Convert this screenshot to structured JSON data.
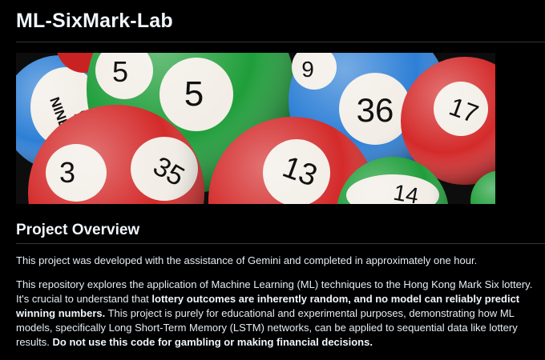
{
  "title": "ML-SixMark-Lab",
  "hero": {
    "ball_numbers": [
      "5",
      "5",
      "9",
      "36",
      "17",
      "9",
      "NINE",
      "3",
      "35",
      "13",
      "14"
    ]
  },
  "overview": {
    "heading": "Project Overview",
    "intro": "This project was developed with the assistance of Gemini and completed in approximately one hour.",
    "p2_seg1": "This repository explores the application of Machine Learning (ML) techniques to the Hong Kong Mark Six lottery. It's crucial to understand that ",
    "p2_bold1": "lottery outcomes are inherently random, and no model can reliably predict winning numbers.",
    "p2_seg2": " This project is purely for educational and experimental purposes, demonstrating how ML models, specifically Long Short-Term Memory (LSTM) networks, can be applied to sequential data like lottery results. ",
    "p2_bold2": "Do not use this code for gambling or making financial decisions."
  },
  "colors": {
    "background": "#000000",
    "text": "#e6edf3",
    "divider": "#30363d",
    "ball_green": "#1f9e3a",
    "ball_blue": "#2d7fd6",
    "ball_red": "#d42a2a"
  }
}
